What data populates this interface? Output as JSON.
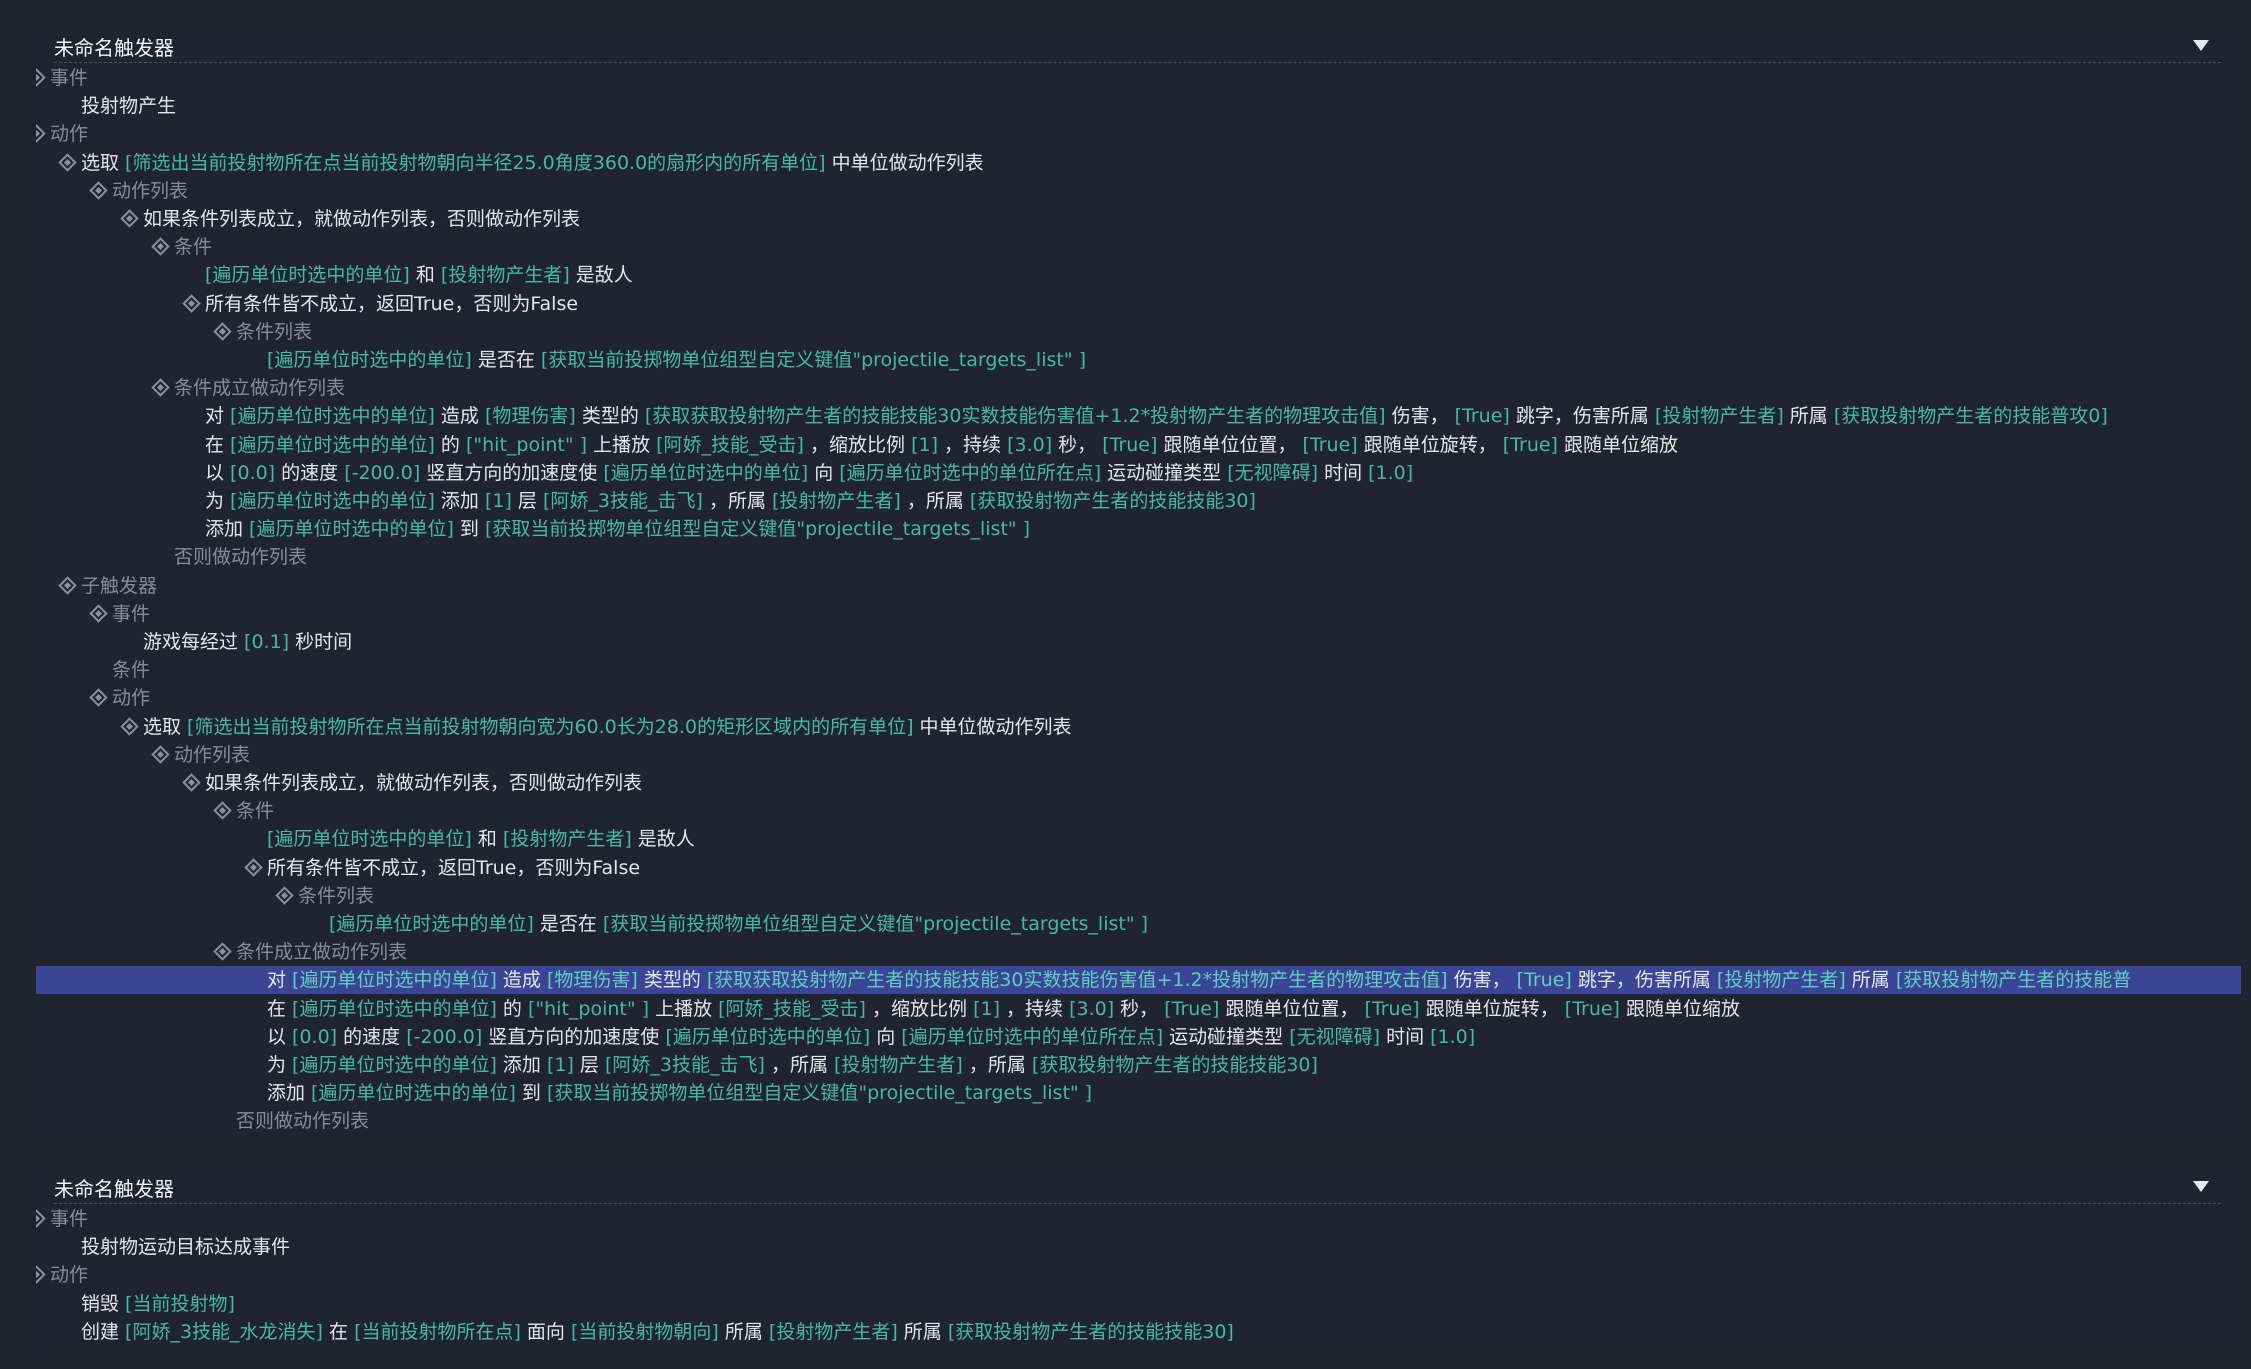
{
  "triggers": [
    {
      "title": "未命名触发器",
      "rows": [
        {
          "depth": 0,
          "icon": true,
          "type": "sec",
          "segs": [
            {
              "t": "事件",
              "c": "sec"
            }
          ]
        },
        {
          "depth": 1,
          "icon": false,
          "segs": [
            {
              "t": "投射物产生",
              "c": "w"
            }
          ]
        },
        {
          "depth": 0,
          "icon": true,
          "type": "sec",
          "segs": [
            {
              "t": "动作",
              "c": "sec"
            }
          ]
        },
        {
          "depth": 1,
          "icon": true,
          "segs": [
            {
              "t": "选取 ",
              "c": "w"
            },
            {
              "t": "[筛选出当前投射物所在点当前投射物朝向半径25.0角度360.0的扇形内的所有单位]",
              "c": "p"
            },
            {
              "t": " 中单位做动作列表",
              "c": "w"
            }
          ]
        },
        {
          "depth": 2,
          "icon": true,
          "segs": [
            {
              "t": "动作列表",
              "c": "sec"
            }
          ]
        },
        {
          "depth": 3,
          "icon": true,
          "segs": [
            {
              "t": "如果条件列表成立，就做动作列表，否则做动作列表",
              "c": "w"
            }
          ]
        },
        {
          "depth": 4,
          "icon": true,
          "segs": [
            {
              "t": "条件",
              "c": "sec"
            }
          ]
        },
        {
          "depth": 5,
          "icon": false,
          "segs": [
            {
              "t": "[遍历单位时选中的单位]",
              "c": "p"
            },
            {
              "t": " 和 ",
              "c": "w"
            },
            {
              "t": "[投射物产生者]",
              "c": "p"
            },
            {
              "t": " 是敌人",
              "c": "w"
            }
          ]
        },
        {
          "depth": 5,
          "icon": true,
          "segs": [
            {
              "t": "所有条件皆不成立，返回True，否则为False",
              "c": "w"
            }
          ]
        },
        {
          "depth": 6,
          "icon": true,
          "segs": [
            {
              "t": "条件列表",
              "c": "sec"
            }
          ]
        },
        {
          "depth": 7,
          "icon": false,
          "segs": [
            {
              "t": "[遍历单位时选中的单位]",
              "c": "p"
            },
            {
              "t": " 是否在 ",
              "c": "w"
            },
            {
              "t": "[获取当前投掷物单位组型自定义键值\"projectile_targets_list\" ]",
              "c": "p"
            }
          ]
        },
        {
          "depth": 4,
          "icon": true,
          "segs": [
            {
              "t": "条件成立做动作列表",
              "c": "sec"
            }
          ]
        },
        {
          "depth": 5,
          "icon": false,
          "segs": [
            {
              "t": "对 ",
              "c": "w"
            },
            {
              "t": "[遍历单位时选中的单位]",
              "c": "p"
            },
            {
              "t": " 造成 ",
              "c": "w"
            },
            {
              "t": "[物理伤害]",
              "c": "p"
            },
            {
              "t": " 类型的 ",
              "c": "w"
            },
            {
              "t": "[获取获取投射物产生者的技能技能30实数技能伤害值+1.2*投射物产生者的物理攻击值]",
              "c": "p"
            },
            {
              "t": " 伤害， ",
              "c": "w"
            },
            {
              "t": "[True]",
              "c": "p"
            },
            {
              "t": " 跳字，伤害所属 ",
              "c": "w"
            },
            {
              "t": "[投射物产生者]",
              "c": "p"
            },
            {
              "t": " 所属 ",
              "c": "w"
            },
            {
              "t": "[获取投射物产生者的技能普攻0]",
              "c": "p"
            }
          ]
        },
        {
          "depth": 5,
          "icon": false,
          "segs": [
            {
              "t": "在 ",
              "c": "w"
            },
            {
              "t": "[遍历单位时选中的单位]",
              "c": "p"
            },
            {
              "t": " 的 ",
              "c": "w"
            },
            {
              "t": "[\"hit_point\" ]",
              "c": "p"
            },
            {
              "t": " 上播放 ",
              "c": "w"
            },
            {
              "t": "[阿娇_技能_受击]",
              "c": "p"
            },
            {
              "t": " ，缩放比例 ",
              "c": "w"
            },
            {
              "t": "[1]",
              "c": "p"
            },
            {
              "t": " ，持续 ",
              "c": "w"
            },
            {
              "t": "[3.0]",
              "c": "p"
            },
            {
              "t": " 秒， ",
              "c": "w"
            },
            {
              "t": "[True]",
              "c": "p"
            },
            {
              "t": " 跟随单位位置， ",
              "c": "w"
            },
            {
              "t": "[True]",
              "c": "p"
            },
            {
              "t": " 跟随单位旋转， ",
              "c": "w"
            },
            {
              "t": "[True]",
              "c": "p"
            },
            {
              "t": " 跟随单位缩放",
              "c": "w"
            }
          ]
        },
        {
          "depth": 5,
          "icon": false,
          "segs": [
            {
              "t": "以 ",
              "c": "w"
            },
            {
              "t": "[0.0]",
              "c": "p"
            },
            {
              "t": " 的速度 ",
              "c": "w"
            },
            {
              "t": "[-200.0]",
              "c": "p"
            },
            {
              "t": " 竖直方向的加速度使 ",
              "c": "w"
            },
            {
              "t": "[遍历单位时选中的单位]",
              "c": "p"
            },
            {
              "t": " 向 ",
              "c": "w"
            },
            {
              "t": "[遍历单位时选中的单位所在点]",
              "c": "p"
            },
            {
              "t": " 运动碰撞类型 ",
              "c": "w"
            },
            {
              "t": "[无视障碍]",
              "c": "p"
            },
            {
              "t": " 时间 ",
              "c": "w"
            },
            {
              "t": "[1.0]",
              "c": "p"
            }
          ]
        },
        {
          "depth": 5,
          "icon": false,
          "segs": [
            {
              "t": "为 ",
              "c": "w"
            },
            {
              "t": "[遍历单位时选中的单位]",
              "c": "p"
            },
            {
              "t": " 添加 ",
              "c": "w"
            },
            {
              "t": "[1]",
              "c": "p"
            },
            {
              "t": " 层 ",
              "c": "w"
            },
            {
              "t": "[阿娇_3技能_击飞]",
              "c": "p"
            },
            {
              "t": " ，所属 ",
              "c": "w"
            },
            {
              "t": "[投射物产生者]",
              "c": "p"
            },
            {
              "t": " ，所属 ",
              "c": "w"
            },
            {
              "t": "[获取投射物产生者的技能技能30]",
              "c": "p"
            }
          ]
        },
        {
          "depth": 5,
          "icon": false,
          "segs": [
            {
              "t": "添加 ",
              "c": "w"
            },
            {
              "t": "[遍历单位时选中的单位]",
              "c": "p"
            },
            {
              "t": " 到 ",
              "c": "w"
            },
            {
              "t": "[获取当前投掷物单位组型自定义键值\"projectile_targets_list\" ]",
              "c": "p"
            }
          ]
        },
        {
          "depth": 4,
          "icon": false,
          "segs": [
            {
              "t": "否则做动作列表",
              "c": "sec"
            }
          ]
        },
        {
          "depth": 1,
          "icon": true,
          "segs": [
            {
              "t": "子触发器",
              "c": "sec"
            }
          ]
        },
        {
          "depth": 2,
          "icon": true,
          "segs": [
            {
              "t": "事件",
              "c": "sec"
            }
          ]
        },
        {
          "depth": 3,
          "icon": false,
          "segs": [
            {
              "t": "游戏每经过 ",
              "c": "w"
            },
            {
              "t": "[0.1]",
              "c": "p"
            },
            {
              "t": " 秒时间",
              "c": "w"
            }
          ]
        },
        {
          "depth": 2,
          "icon": false,
          "segs": [
            {
              "t": "条件",
              "c": "sec"
            }
          ]
        },
        {
          "depth": 2,
          "icon": true,
          "segs": [
            {
              "t": "动作",
              "c": "sec"
            }
          ]
        },
        {
          "depth": 3,
          "icon": true,
          "segs": [
            {
              "t": "选取 ",
              "c": "w"
            },
            {
              "t": "[筛选出当前投射物所在点当前投射物朝向宽为60.0长为28.0的矩形区域内的所有单位]",
              "c": "p"
            },
            {
              "t": " 中单位做动作列表",
              "c": "w"
            }
          ]
        },
        {
          "depth": 4,
          "icon": true,
          "segs": [
            {
              "t": "动作列表",
              "c": "sec"
            }
          ]
        },
        {
          "depth": 5,
          "icon": true,
          "segs": [
            {
              "t": "如果条件列表成立，就做动作列表，否则做动作列表",
              "c": "w"
            }
          ]
        },
        {
          "depth": 6,
          "icon": true,
          "segs": [
            {
              "t": "条件",
              "c": "sec"
            }
          ]
        },
        {
          "depth": 7,
          "icon": false,
          "segs": [
            {
              "t": "[遍历单位时选中的单位]",
              "c": "p"
            },
            {
              "t": " 和 ",
              "c": "w"
            },
            {
              "t": "[投射物产生者]",
              "c": "p"
            },
            {
              "t": " 是敌人",
              "c": "w"
            }
          ]
        },
        {
          "depth": 7,
          "icon": true,
          "segs": [
            {
              "t": "所有条件皆不成立，返回True，否则为False",
              "c": "w"
            }
          ]
        },
        {
          "depth": 8,
          "icon": true,
          "segs": [
            {
              "t": "条件列表",
              "c": "sec"
            }
          ]
        },
        {
          "depth": 9,
          "icon": false,
          "segs": [
            {
              "t": "[遍历单位时选中的单位]",
              "c": "p"
            },
            {
              "t": " 是否在 ",
              "c": "w"
            },
            {
              "t": "[获取当前投掷物单位组型自定义键值\"projectile_targets_list\" ]",
              "c": "p"
            }
          ]
        },
        {
          "depth": 6,
          "icon": true,
          "segs": [
            {
              "t": "条件成立做动作列表",
              "c": "sec"
            }
          ]
        },
        {
          "depth": 7,
          "icon": false,
          "selected": true,
          "segs": [
            {
              "t": "对 ",
              "c": "w"
            },
            {
              "t": "[遍历单位时选中的单位]",
              "c": "p"
            },
            {
              "t": " 造成 ",
              "c": "w"
            },
            {
              "t": "[物理伤害]",
              "c": "p"
            },
            {
              "t": " 类型的 ",
              "c": "w"
            },
            {
              "t": "[获取获取投射物产生者的技能技能30实数技能伤害值+1.2*投射物产生者的物理攻击值]",
              "c": "p"
            },
            {
              "t": " 伤害， ",
              "c": "w"
            },
            {
              "t": "[True]",
              "c": "p"
            },
            {
              "t": " 跳字，伤害所属 ",
              "c": "w"
            },
            {
              "t": "[投射物产生者]",
              "c": "p"
            },
            {
              "t": " 所属 ",
              "c": "w"
            },
            {
              "t": "[获取投射物产生者的技能普",
              "c": "p"
            }
          ]
        },
        {
          "depth": 7,
          "icon": false,
          "segs": [
            {
              "t": "在 ",
              "c": "w"
            },
            {
              "t": "[遍历单位时选中的单位]",
              "c": "p"
            },
            {
              "t": " 的 ",
              "c": "w"
            },
            {
              "t": "[\"hit_point\" ]",
              "c": "p"
            },
            {
              "t": " 上播放 ",
              "c": "w"
            },
            {
              "t": "[阿娇_技能_受击]",
              "c": "p"
            },
            {
              "t": " ，缩放比例 ",
              "c": "w"
            },
            {
              "t": "[1]",
              "c": "p"
            },
            {
              "t": " ，持续 ",
              "c": "w"
            },
            {
              "t": "[3.0]",
              "c": "p"
            },
            {
              "t": " 秒， ",
              "c": "w"
            },
            {
              "t": "[True]",
              "c": "p"
            },
            {
              "t": " 跟随单位位置， ",
              "c": "w"
            },
            {
              "t": "[True]",
              "c": "p"
            },
            {
              "t": " 跟随单位旋转， ",
              "c": "w"
            },
            {
              "t": "[True]",
              "c": "p"
            },
            {
              "t": " 跟随单位缩放",
              "c": "w"
            }
          ]
        },
        {
          "depth": 7,
          "icon": false,
          "segs": [
            {
              "t": "以 ",
              "c": "w"
            },
            {
              "t": "[0.0]",
              "c": "p"
            },
            {
              "t": " 的速度 ",
              "c": "w"
            },
            {
              "t": "[-200.0]",
              "c": "p"
            },
            {
              "t": " 竖直方向的加速度使 ",
              "c": "w"
            },
            {
              "t": "[遍历单位时选中的单位]",
              "c": "p"
            },
            {
              "t": " 向 ",
              "c": "w"
            },
            {
              "t": "[遍历单位时选中的单位所在点]",
              "c": "p"
            },
            {
              "t": " 运动碰撞类型 ",
              "c": "w"
            },
            {
              "t": "[无视障碍]",
              "c": "p"
            },
            {
              "t": " 时间 ",
              "c": "w"
            },
            {
              "t": "[1.0]",
              "c": "p"
            }
          ]
        },
        {
          "depth": 7,
          "icon": false,
          "segs": [
            {
              "t": "为 ",
              "c": "w"
            },
            {
              "t": "[遍历单位时选中的单位]",
              "c": "p"
            },
            {
              "t": " 添加 ",
              "c": "w"
            },
            {
              "t": "[1]",
              "c": "p"
            },
            {
              "t": " 层 ",
              "c": "w"
            },
            {
              "t": "[阿娇_3技能_击飞]",
              "c": "p"
            },
            {
              "t": " ，所属 ",
              "c": "w"
            },
            {
              "t": "[投射物产生者]",
              "c": "p"
            },
            {
              "t": " ，所属 ",
              "c": "w"
            },
            {
              "t": "[获取投射物产生者的技能技能30]",
              "c": "p"
            }
          ]
        },
        {
          "depth": 7,
          "icon": false,
          "segs": [
            {
              "t": "添加 ",
              "c": "w"
            },
            {
              "t": "[遍历单位时选中的单位]",
              "c": "p"
            },
            {
              "t": " 到 ",
              "c": "w"
            },
            {
              "t": "[获取当前投掷物单位组型自定义键值\"projectile_targets_list\" ]",
              "c": "p"
            }
          ]
        },
        {
          "depth": 6,
          "icon": false,
          "segs": [
            {
              "t": "否则做动作列表",
              "c": "sec"
            }
          ]
        }
      ]
    },
    {
      "title": "未命名触发器",
      "rows": [
        {
          "depth": 0,
          "icon": true,
          "segs": [
            {
              "t": "事件",
              "c": "sec"
            }
          ]
        },
        {
          "depth": 1,
          "icon": false,
          "segs": [
            {
              "t": "投射物运动目标达成事件",
              "c": "w"
            }
          ]
        },
        {
          "depth": 0,
          "icon": true,
          "segs": [
            {
              "t": "动作",
              "c": "sec"
            }
          ]
        },
        {
          "depth": 1,
          "icon": false,
          "segs": [
            {
              "t": "销毁 ",
              "c": "w"
            },
            {
              "t": "[当前投射物]",
              "c": "p"
            }
          ]
        },
        {
          "depth": 1,
          "icon": false,
          "segs": [
            {
              "t": "创建 ",
              "c": "w"
            },
            {
              "t": "[阿娇_3技能_水龙消失]",
              "c": "p"
            },
            {
              "t": " 在 ",
              "c": "w"
            },
            {
              "t": "[当前投射物所在点]",
              "c": "p"
            },
            {
              "t": " 面向 ",
              "c": "w"
            },
            {
              "t": "[当前投射物朝向]",
              "c": "p"
            },
            {
              "t": " 所属 ",
              "c": "w"
            },
            {
              "t": "[投射物产生者]",
              "c": "p"
            },
            {
              "t": " 所属 ",
              "c": "w"
            },
            {
              "t": "[获取投射物产生者的技能技能30]",
              "c": "p"
            }
          ]
        }
      ]
    }
  ],
  "colors": {
    "background": "#1f232e",
    "param": "#46b8a8",
    "section": "#878c97",
    "text": "#e4e6ea",
    "selection": "#3b4595"
  }
}
